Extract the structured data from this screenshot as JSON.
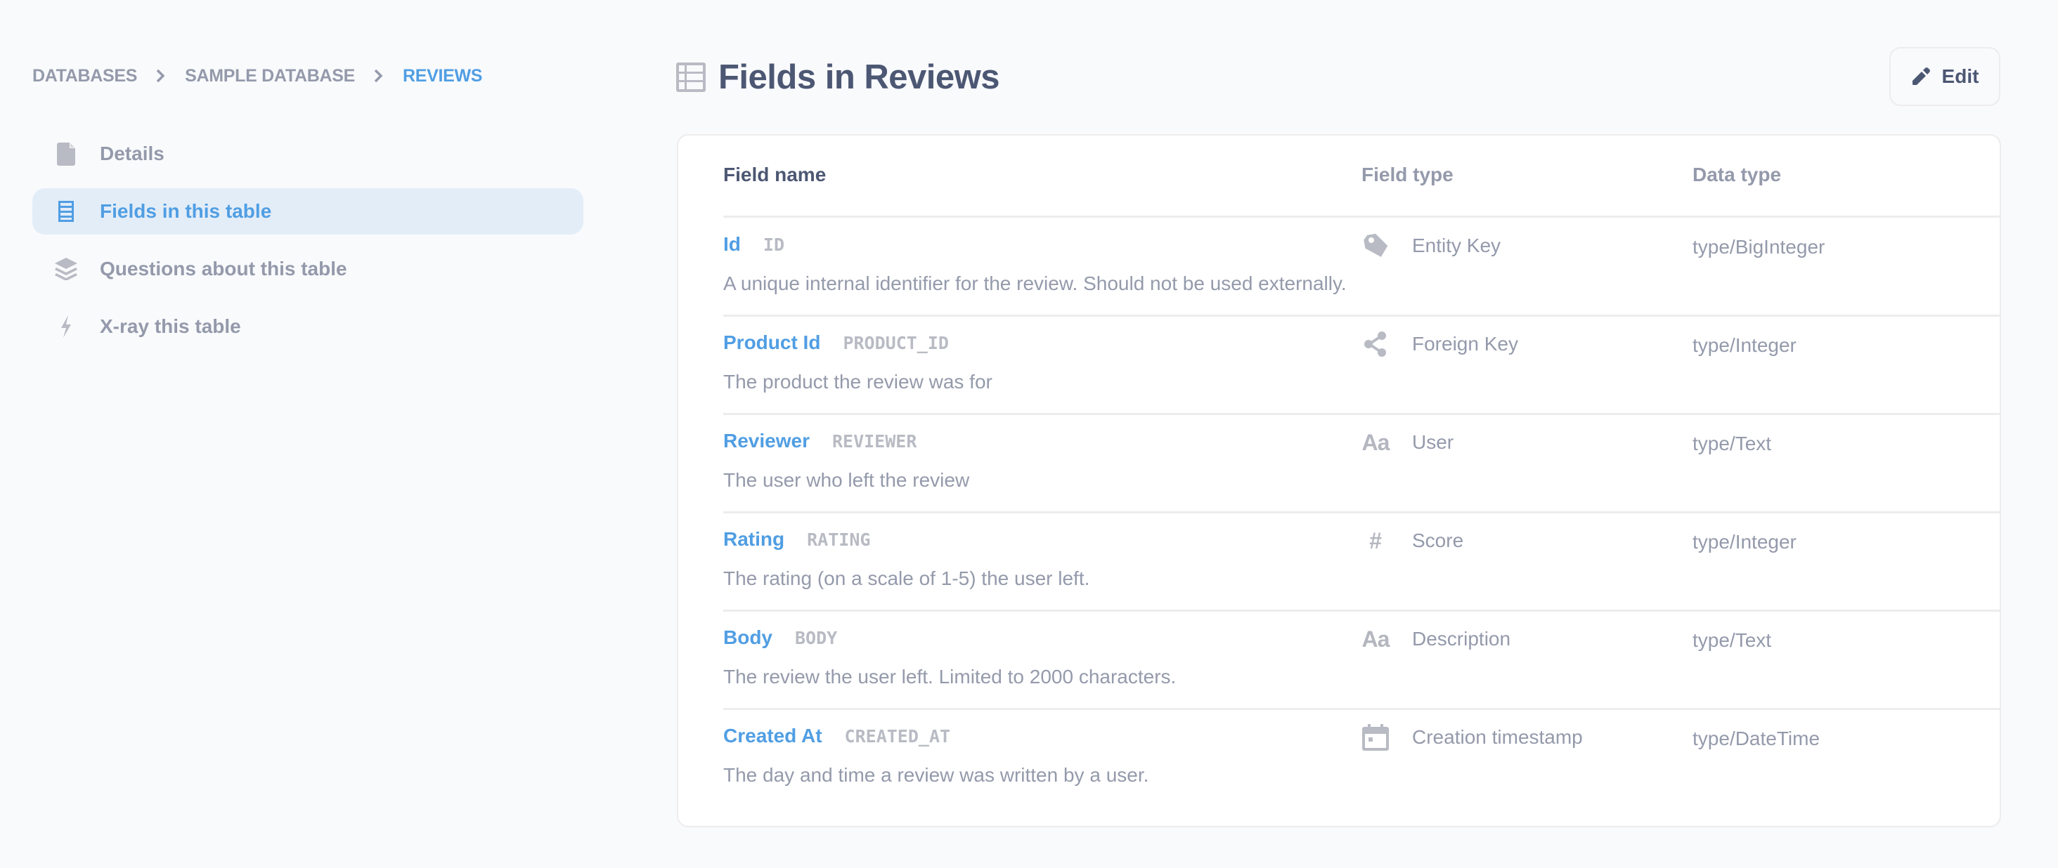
{
  "breadcrumb": [
    {
      "label": "DATABASES",
      "active": false
    },
    {
      "label": "SAMPLE DATABASE",
      "active": false
    },
    {
      "label": "REVIEWS",
      "active": true
    }
  ],
  "sidebar": {
    "items": [
      {
        "label": "Details",
        "icon": "document-icon",
        "active": false
      },
      {
        "label": "Fields in this table",
        "icon": "list-icon",
        "active": true
      },
      {
        "label": "Questions about this table",
        "icon": "layers-icon",
        "active": false
      },
      {
        "label": "X-ray this table",
        "icon": "bolt-icon",
        "active": false
      }
    ]
  },
  "header": {
    "title": "Fields in Reviews",
    "title_icon": "table-icon",
    "edit_label": "Edit",
    "edit_icon": "pencil-icon"
  },
  "table": {
    "columns": {
      "field_name": "Field name",
      "field_type": "Field type",
      "data_type": "Data type"
    },
    "rows": [
      {
        "display_name": "Id",
        "column_name": "ID",
        "description": "A unique internal identifier for the review. Should not be used externally.",
        "field_type": "Entity Key",
        "field_type_icon": "tag-icon",
        "data_type": "type/BigInteger"
      },
      {
        "display_name": "Product Id",
        "column_name": "PRODUCT_ID",
        "description": "The product the review was for",
        "field_type": "Foreign Key",
        "field_type_icon": "share-icon",
        "data_type": "type/Integer"
      },
      {
        "display_name": "Reviewer",
        "column_name": "REVIEWER",
        "description": "The user who left the review",
        "field_type": "User",
        "field_type_icon": "text-icon",
        "data_type": "type/Text"
      },
      {
        "display_name": "Rating",
        "column_name": "RATING",
        "description": "The rating (on a scale of 1-5) the user left.",
        "field_type": "Score",
        "field_type_icon": "number-icon",
        "data_type": "type/Integer"
      },
      {
        "display_name": "Body",
        "column_name": "BODY",
        "description": "The review the user left. Limited to 2000 characters.",
        "field_type": "Description",
        "field_type_icon": "text-icon",
        "data_type": "type/Text"
      },
      {
        "display_name": "Created At",
        "column_name": "CREATED_AT",
        "description": "The day and time a review was written by a user.",
        "field_type": "Creation timestamp",
        "field_type_icon": "calendar-icon",
        "data_type": "type/DateTime"
      }
    ]
  },
  "icon_glyphs": {
    "text-icon": "Aa",
    "number-icon": "#"
  },
  "colors": {
    "brand": "#509EE3",
    "text_dark": "#4C5773",
    "text_medium": "#949AAB",
    "text_light": "#B4B7BF",
    "border": "#EEECEC",
    "background": "#F9FAFC",
    "active_bg": "#E3EDF8"
  }
}
